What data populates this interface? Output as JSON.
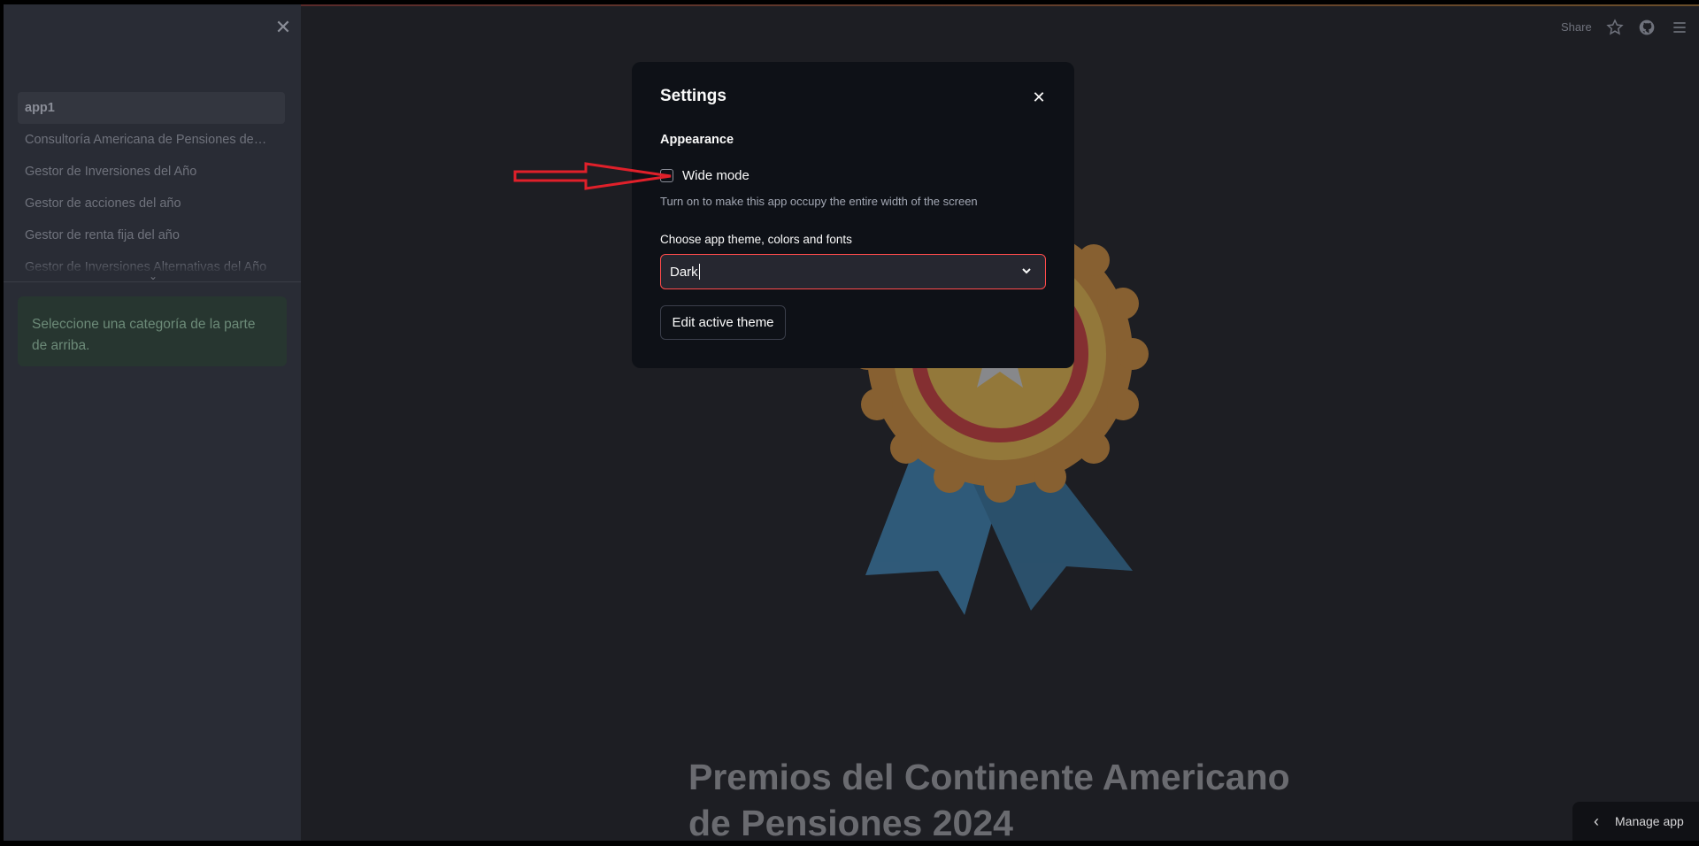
{
  "sidebar": {
    "close_icon": "close-icon",
    "nav_items": [
      {
        "label": "app1",
        "active": true
      },
      {
        "label": "Consultoría Americana de Pensiones de…"
      },
      {
        "label": "Gestor de Inversiones del Año"
      },
      {
        "label": "Gestor de acciones del año"
      },
      {
        "label": "Gestor de renta fija del año"
      },
      {
        "label": "Gestor de Inversiones Alternativas del Año"
      }
    ],
    "expand_icon": "chevron-down-icon",
    "info_text": "Seleccione una categoría de la parte de arriba."
  },
  "toolbar": {
    "share_label": "Share",
    "icons": [
      "star-icon",
      "github-icon",
      "hamburger-menu-icon"
    ]
  },
  "main": {
    "headline": "Premios del Continente Americano de Pensiones 2024",
    "medal_icon": "award-medal-icon"
  },
  "settings": {
    "title": "Settings",
    "close_icon": "close-icon",
    "appearance_label": "Appearance",
    "wide_mode_label": "Wide mode",
    "wide_mode_checked": false,
    "wide_mode_help": "Turn on to make this app occupy the entire width of the screen",
    "theme_label": "Choose app theme, colors and fonts",
    "theme_value": "Dark",
    "edit_theme_label": "Edit active theme"
  },
  "manage_app": {
    "label": "Manage app",
    "icon": "chevron-left-icon"
  },
  "annotation": {
    "icon": "red-arrow-annotation",
    "color": "#e0202a"
  },
  "colors": {
    "accent": "#ff4b4b",
    "modal_bg": "#0e1117",
    "main_bg": "#1d1e23",
    "sidebar_bg": "#292c35"
  }
}
